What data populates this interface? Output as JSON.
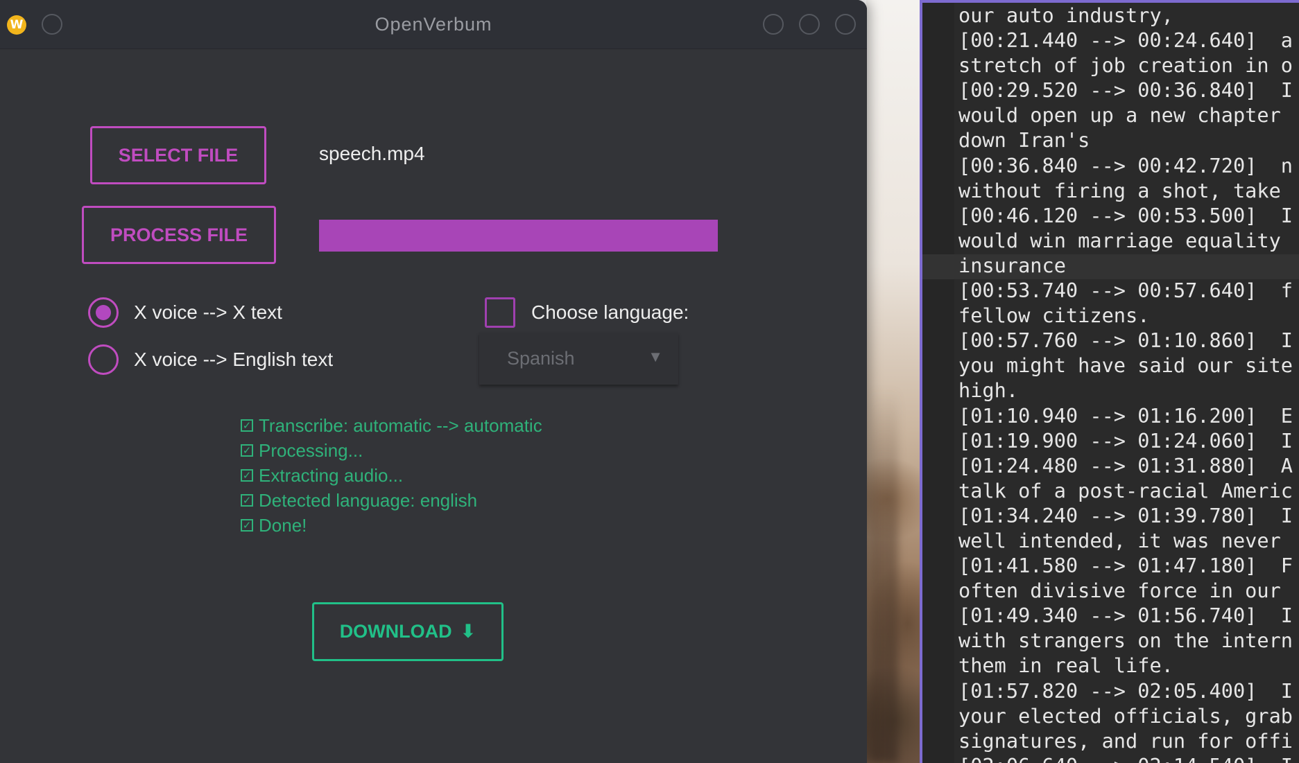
{
  "app": {
    "title": "OpenVerbum",
    "logo_letter": "W"
  },
  "file": {
    "select_label": "SELECT FILE",
    "process_label": "PROCESS FILE",
    "filename": "speech.mp4",
    "progress_fraction": 1.0
  },
  "modes": [
    {
      "label": "X voice --> X text",
      "selected": true
    },
    {
      "label": "X voice --> English text",
      "selected": false
    }
  ],
  "language": {
    "checkbox_label": "Choose language:",
    "checked": false,
    "selected": "Spanish"
  },
  "status_lines": [
    "Transcribe: automatic --> automatic",
    "Processing...",
    "Extracting audio...",
    "Detected language: english",
    "Done!"
  ],
  "download_label": "DOWNLOAD",
  "colors": {
    "accent_pink": "#c04cc0",
    "progress_fill": "#a845b7",
    "status_green": "#2fb27a",
    "download_green": "#21c088",
    "window_bg": "#333438"
  },
  "icons": [
    "app-logo-icon",
    "radio-selected-icon",
    "checkbox-icon",
    "dropdown-arrow-icon",
    "check-icon",
    "download-arrow-icon"
  ],
  "terminal": {
    "lines": [
      "our auto industry,",
      "[00:21.440 --> 00:24.640]  a",
      "stretch of job creation in o",
      "[00:29.520 --> 00:36.840]  I",
      "would open up a new chapter",
      "down Iran's",
      "[00:36.840 --> 00:42.720]  n",
      "without firing a shot, take",
      "[00:46.120 --> 00:53.500]  I",
      "would win marriage equality",
      "insurance",
      "[00:53.740 --> 00:57.640]  f",
      "fellow citizens.",
      "[00:57.760 --> 01:10.860]  I",
      "you might have said our site",
      "high.",
      "[01:10.940 --> 01:16.200]  E",
      "[01:19.900 --> 01:24.060]  I",
      "[01:24.480 --> 01:31.880]  A",
      "talk of a post-racial Americ",
      "[01:34.240 --> 01:39.780]  I",
      "well intended, it was never",
      "[01:41.580 --> 01:47.180]  F",
      "often divisive force in our",
      "[01:49.340 --> 01:56.740]  I",
      "with strangers on the intern",
      "them in real life.",
      "[01:57.820 --> 02:05.400]  I",
      "your elected officials, grab",
      "signatures, and run for offi",
      "[02:06.640 --> 02:14.540]  I"
    ]
  }
}
